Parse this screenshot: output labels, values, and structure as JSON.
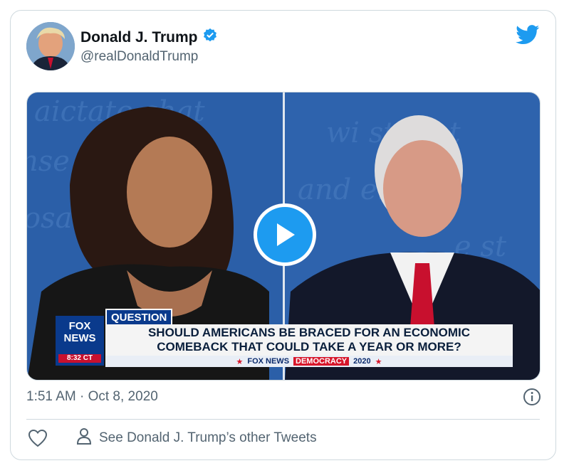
{
  "tweet": {
    "author_name": "Donald J. Trump",
    "handle": "@realDonaldTrump",
    "timestamp": "1:51 AM · Oct 8, 2020",
    "see_more": "See Donald J. Trump’s other Tweets"
  },
  "media": {
    "question_label": "QUESTION",
    "question_line1": "SHOULD AMERICANS BE BRACED FOR AN ECONOMIC",
    "question_line2": "COMEBACK THAT COULD TAKE A YEAR OR MORE?",
    "network_line1": "FOX",
    "network_line2": "NEWS",
    "clock": "8:32 CT",
    "bar_network": "FOX NEWS",
    "bar_democracy": "DEMOCRACY",
    "bar_year": "2020"
  },
  "colors": {
    "accent": "#1d9bf0",
    "text": "#0f1419",
    "muted": "#536471"
  },
  "icons": [
    "verified-icon",
    "twitter-bird-icon",
    "play-icon",
    "info-icon",
    "heart-icon",
    "person-icon"
  ]
}
